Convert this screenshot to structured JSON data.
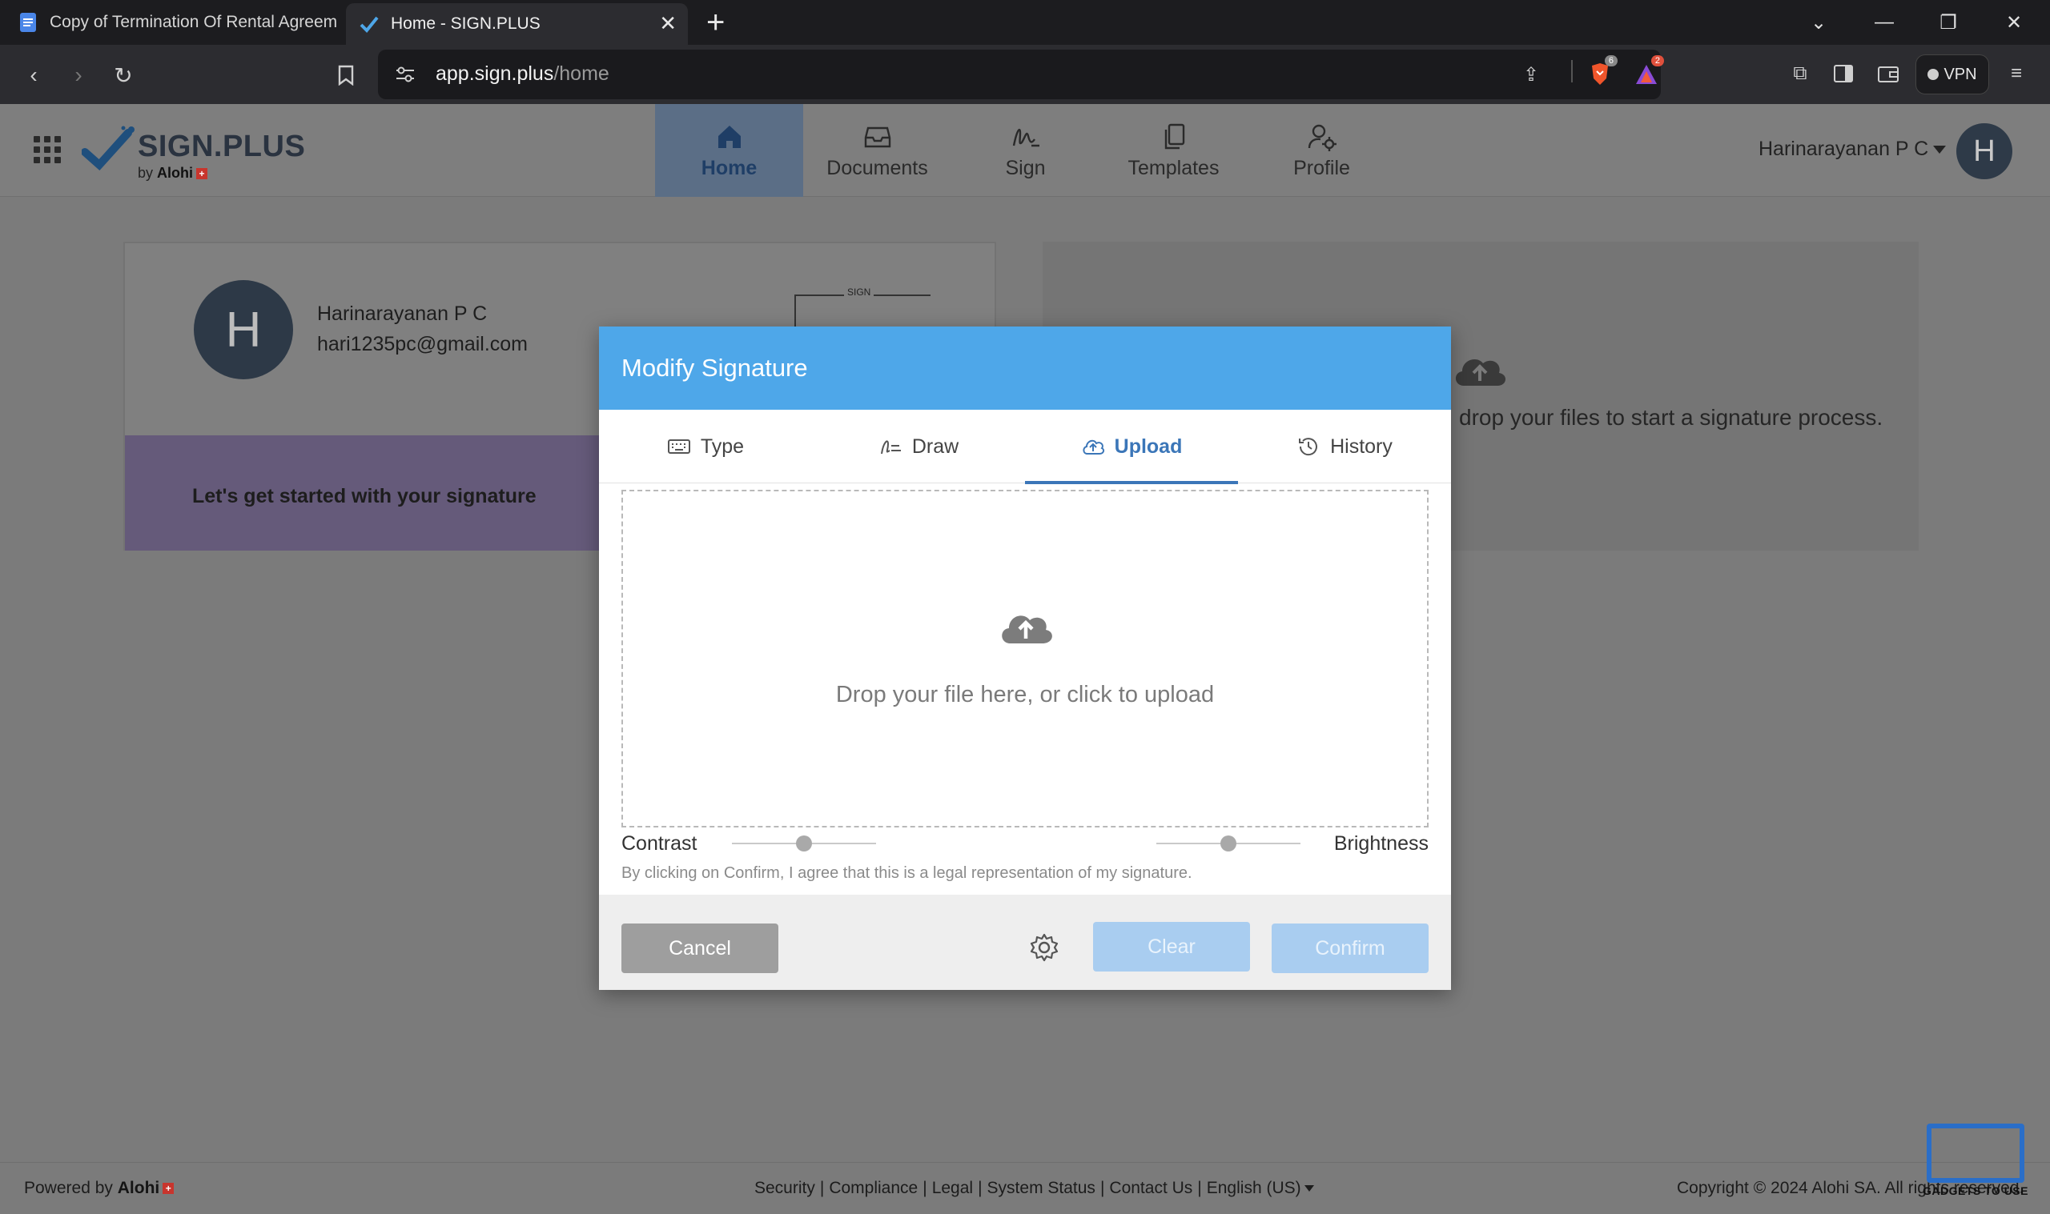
{
  "browser": {
    "tabs": [
      {
        "title": "Copy of Termination Of Rental Agreem",
        "active": false,
        "favicon": "docs-icon"
      },
      {
        "title": "Home - SIGN.PLUS",
        "active": true,
        "favicon": "signplus-icon"
      }
    ],
    "url_host": "app.sign.plus",
    "url_path": "/home",
    "brave_badge": "6",
    "rewards_badge": "2",
    "vpn_label": "VPN"
  },
  "app": {
    "logo_text": "SIGN.PLUS",
    "logo_sub_by": "by",
    "logo_sub_brand": "Alohi",
    "nav": [
      {
        "label": "Home",
        "icon": "home-icon",
        "active": true
      },
      {
        "label": "Documents",
        "icon": "inbox-icon",
        "active": false
      },
      {
        "label": "Sign",
        "icon": "signature-icon",
        "active": false
      },
      {
        "label": "Templates",
        "icon": "copy-icon",
        "active": false
      },
      {
        "label": "Profile",
        "icon": "user-gear-icon",
        "active": false
      }
    ],
    "user_name": "Harinarayanan P C",
    "avatar_initial": "H"
  },
  "profile_card": {
    "initial": "H",
    "name": "Harinarayanan P C",
    "email": "hari1235pc@gmail.com",
    "thumb_label": "SIGN",
    "banner": "Let's get started with your signature"
  },
  "drop_card": {
    "text": "drop your files to start a signature process."
  },
  "modal": {
    "title": "Modify Signature",
    "tabs": [
      {
        "label": "Type",
        "icon": "keyboard-icon",
        "active": false
      },
      {
        "label": "Draw",
        "icon": "pen-icon",
        "active": false
      },
      {
        "label": "Upload",
        "icon": "cloud-upload-icon",
        "active": true
      },
      {
        "label": "History",
        "icon": "history-icon",
        "active": false
      }
    ],
    "dropzone_text": "Drop your file here, or click to upload",
    "contrast_label": "Contrast",
    "brightness_label": "Brightness",
    "contrast_value": 0.5,
    "brightness_value": 0.5,
    "legal_text": "By clicking on Confirm, I agree that this is a legal representation of my signature.",
    "cancel_label": "Cancel",
    "clear_label": "Clear",
    "confirm_label": "Confirm"
  },
  "footer": {
    "powered_by": "Powered by",
    "powered_brand": "Alohi",
    "links": [
      "Security",
      "Compliance",
      "Legal",
      "System Status",
      "Contact Us",
      "English (US)"
    ],
    "copyright": "Copyright © 2024 Alohi SA. All rights reserved."
  },
  "watermark": {
    "text": "GADGETS TO USE"
  },
  "colors": {
    "modal_header": "#4ea7e9",
    "accent": "#3b76b8",
    "disabled_button": "#a9cdf0"
  }
}
